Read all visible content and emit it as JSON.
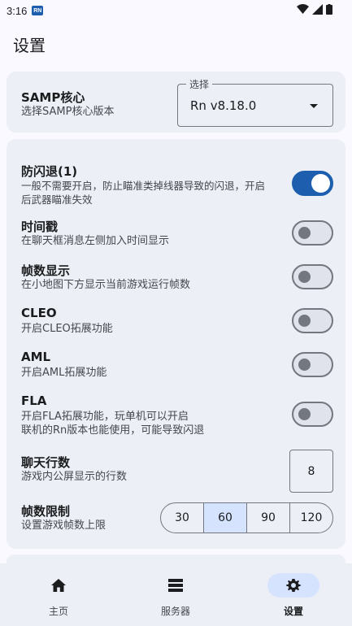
{
  "status": {
    "time": "3:16",
    "app_badge": "RN"
  },
  "page": {
    "title": "设置"
  },
  "samp_core": {
    "title": "SAMP核心",
    "subtitle": "选择SAMP核心版本",
    "select_label": "选择",
    "select_value": "Rn v8.18.0"
  },
  "settings": {
    "anti_flash": {
      "title": "防闪退(1)",
      "desc_line1": "一般不需要开启，防止瞄准类掉线器导致的闪退，开启",
      "desc_line2": "后武器瞄准失效",
      "enabled": true
    },
    "timestamp": {
      "title": "时间戳",
      "desc": "在聊天框消息左侧加入时间显示",
      "enabled": false
    },
    "fps_display": {
      "title": "帧数显示",
      "desc": "在小地图下方显示当前游戏运行帧数",
      "enabled": false
    },
    "cleo": {
      "title": "CLEO",
      "desc": "开启CLEO拓展功能",
      "enabled": false
    },
    "aml": {
      "title": "AML",
      "desc": "开启AML拓展功能",
      "enabled": false
    },
    "fla": {
      "title": "FLA",
      "desc_line1": "开启FLA拓展功能，玩单机可以开启",
      "desc_line2": "联机的Rn版本也能使用，可能导致闪退",
      "enabled": false
    },
    "chat_lines": {
      "title": "聊天行数",
      "desc": "游戏内公屏显示的行数",
      "value": "8"
    },
    "fps_limit": {
      "title": "帧数限制",
      "desc": "设置游戏帧数上限",
      "options": [
        "30",
        "60",
        "90",
        "120"
      ],
      "selected": "60"
    }
  },
  "nav": {
    "items": [
      {
        "label": "主页",
        "icon": "home-icon"
      },
      {
        "label": "服务器",
        "icon": "server-list-icon"
      },
      {
        "label": "设置",
        "icon": "gear-icon"
      }
    ],
    "active": "设置"
  },
  "colors": {
    "accent": "#1d5fae",
    "selected_bg": "#d5e3ff",
    "card_bg": "#eceff6"
  }
}
